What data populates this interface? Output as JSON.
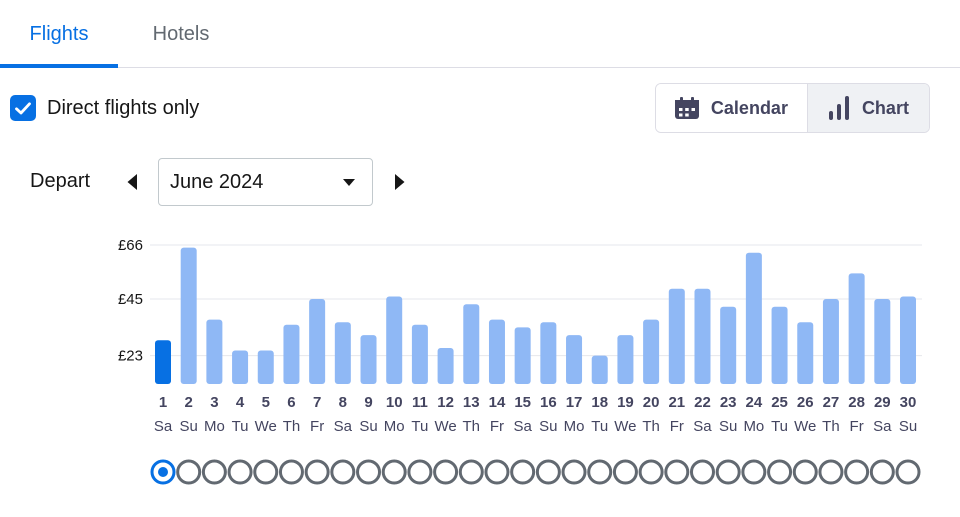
{
  "tabs": [
    {
      "label": "Flights",
      "active": true
    },
    {
      "label": "Hotels",
      "active": false
    }
  ],
  "filters": {
    "direct_label": "Direct flights only",
    "direct_checked": true
  },
  "view_toggle": {
    "calendar_label": "Calendar",
    "chart_label": "Chart",
    "selected": "Chart"
  },
  "depart": {
    "label": "Depart",
    "month": "June 2024"
  },
  "icons": {
    "calendar": "calendar-icon",
    "chart": "bar-chart-icon",
    "prev": "triangle-left-icon",
    "next": "triangle-right-icon",
    "caret": "caret-down-icon",
    "check": "checkmark-icon"
  },
  "colors": {
    "accent": "#0770e3",
    "bar": "#8fb8f5",
    "bar_selected": "#0770e3",
    "text_secondary": "#626971"
  },
  "chart_data": {
    "type": "bar",
    "currency_unit": "£",
    "y_ticks": [
      "£66",
      "£45",
      "£23"
    ],
    "y_tick_values": [
      66,
      45,
      23
    ],
    "ylim": [
      12,
      66
    ],
    "selected_day": 1,
    "grid": true,
    "days": [
      {
        "day": "1",
        "weekday": "Sa",
        "value": 29
      },
      {
        "day": "2",
        "weekday": "Su",
        "value": 65
      },
      {
        "day": "3",
        "weekday": "Mo",
        "value": 37
      },
      {
        "day": "4",
        "weekday": "Tu",
        "value": 25
      },
      {
        "day": "5",
        "weekday": "We",
        "value": 25
      },
      {
        "day": "6",
        "weekday": "Th",
        "value": 35
      },
      {
        "day": "7",
        "weekday": "Fr",
        "value": 45
      },
      {
        "day": "8",
        "weekday": "Sa",
        "value": 36
      },
      {
        "day": "9",
        "weekday": "Su",
        "value": 31
      },
      {
        "day": "10",
        "weekday": "Mo",
        "value": 46
      },
      {
        "day": "11",
        "weekday": "Tu",
        "value": 35
      },
      {
        "day": "12",
        "weekday": "We",
        "value": 26
      },
      {
        "day": "13",
        "weekday": "Th",
        "value": 43
      },
      {
        "day": "14",
        "weekday": "Fr",
        "value": 37
      },
      {
        "day": "15",
        "weekday": "Sa",
        "value": 34
      },
      {
        "day": "16",
        "weekday": "Su",
        "value": 36
      },
      {
        "day": "17",
        "weekday": "Mo",
        "value": 31
      },
      {
        "day": "18",
        "weekday": "Tu",
        "value": 23
      },
      {
        "day": "19",
        "weekday": "We",
        "value": 31
      },
      {
        "day": "20",
        "weekday": "Th",
        "value": 37
      },
      {
        "day": "21",
        "weekday": "Fr",
        "value": 49
      },
      {
        "day": "22",
        "weekday": "Sa",
        "value": 49
      },
      {
        "day": "23",
        "weekday": "Su",
        "value": 42
      },
      {
        "day": "24",
        "weekday": "Mo",
        "value": 63
      },
      {
        "day": "25",
        "weekday": "Tu",
        "value": 42
      },
      {
        "day": "26",
        "weekday": "We",
        "value": 36
      },
      {
        "day": "27",
        "weekday": "Th",
        "value": 45
      },
      {
        "day": "28",
        "weekday": "Fr",
        "value": 55
      },
      {
        "day": "29",
        "weekday": "Sa",
        "value": 45
      },
      {
        "day": "30",
        "weekday": "Su",
        "value": 46
      }
    ]
  }
}
